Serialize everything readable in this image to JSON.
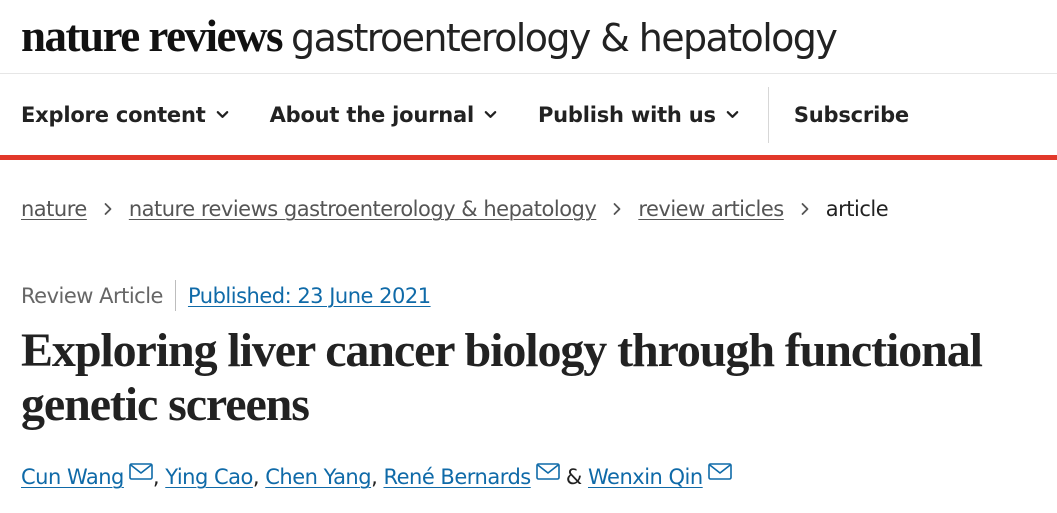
{
  "masthead": {
    "brand_strong": "nature reviews",
    "brand_light": "gastroenterology & hepatology"
  },
  "nav": {
    "explore": "Explore content",
    "about": "About the journal",
    "publish": "Publish with us",
    "subscribe": "Subscribe"
  },
  "breadcrumb": {
    "items": [
      "nature",
      "nature reviews gastroenterology & hepatology",
      "review articles"
    ],
    "current": "article"
  },
  "article": {
    "type": "Review Article",
    "published": "Published: 23 June 2021",
    "title_line1": "Exploring liver cancer biology through functional",
    "title_line2": "genetic screens"
  },
  "authors": {
    "list": [
      "Cun Wang",
      "Ying Cao",
      "Chen Yang",
      "René Bernards",
      "Wenxin Qin"
    ],
    "sep_comma": ",",
    "sep_and": "&"
  },
  "colors": {
    "accent_red": "#e2382a",
    "link_blue": "#0f6aa8"
  },
  "icons": {
    "nav_dropdown": "chevron-down-icon",
    "breadcrumb_separator": "chevron-right-icon",
    "author_contact": "mail-icon"
  }
}
